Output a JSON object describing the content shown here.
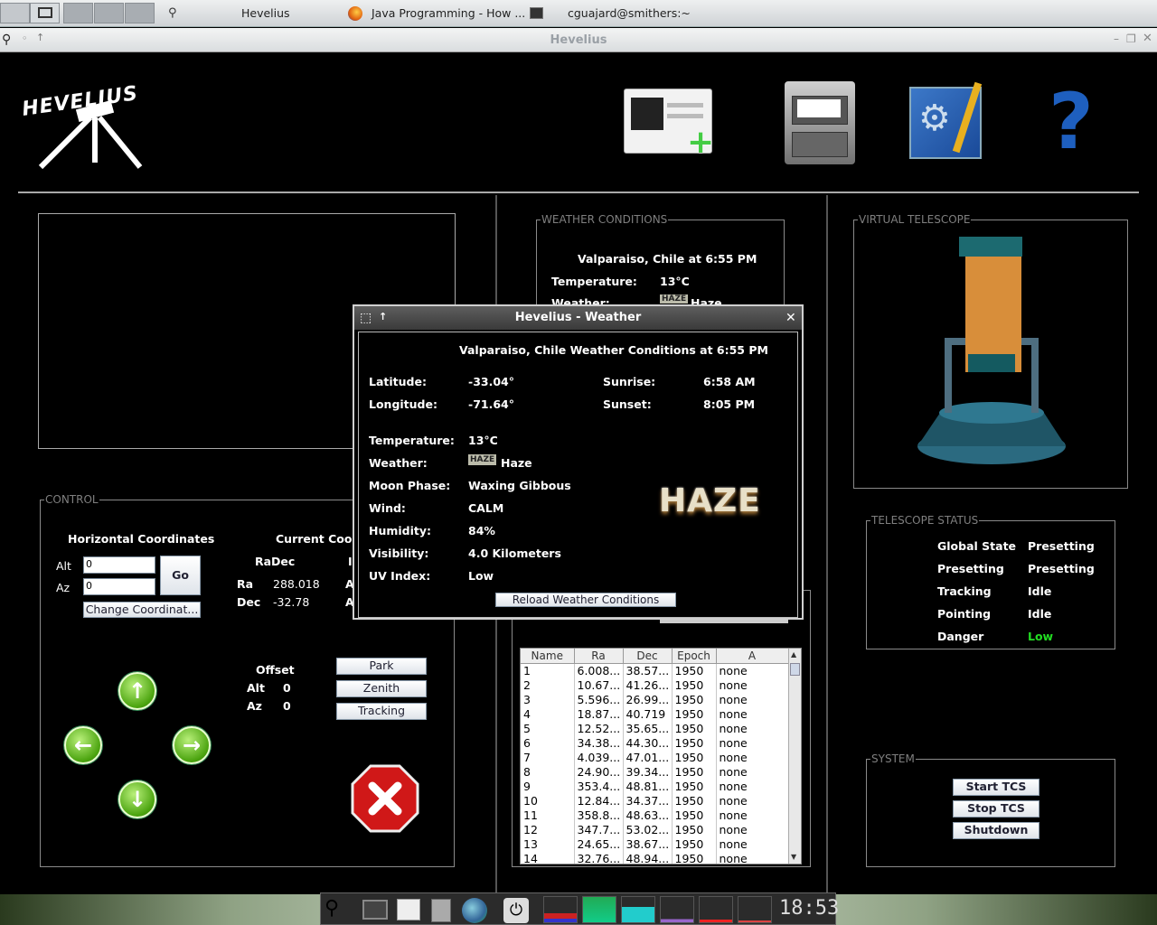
{
  "taskbar": {
    "tasks": [
      "Hevelius",
      "Java Programming - How ...",
      "cguajard@smithers:~"
    ]
  },
  "window": {
    "title": "Hevelius"
  },
  "logo": {
    "text": "HEVELIUS"
  },
  "control": {
    "legend": "CONTROL",
    "horizontal_title": "Horizontal Coordinates",
    "alt_label": "Alt",
    "az_label": "Az",
    "alt_value": "0",
    "az_value": "0",
    "go_label": "Go",
    "change_label": "Change Coordinat...",
    "current_title": "Current Coord",
    "radec_header": "RaDec",
    "radec_header2": "I",
    "ra_label": "Ra",
    "ra_value": "288.018",
    "ra_cut": "A",
    "dec_label": "Dec",
    "dec_value": "-32.78",
    "dec_cut": "A",
    "offset_title": "Offset",
    "offset_alt_label": "Alt",
    "offset_alt_value": "0",
    "offset_az_label": "Az",
    "offset_az_value": "0",
    "park_label": "Park",
    "zenith_label": "Zenith",
    "tracking_label": "Tracking"
  },
  "weather_panel": {
    "legend": "WEATHER CONDITIONS",
    "location": "Valparaiso, Chile at 6:55 PM",
    "temperature_label": "Temperature:",
    "temperature": "13°C",
    "weather_label": "Weather:",
    "weather_value": "Haze",
    "weather_badge": "HAZE"
  },
  "virtual_telescope": {
    "legend": "VIRTUAL TELESCOPE"
  },
  "telescope_status": {
    "legend": "TELESCOPE STATUS",
    "rows": [
      {
        "label": "Global State",
        "value": "Presetting"
      },
      {
        "label": "Presetting",
        "value": "Presetting"
      },
      {
        "label": "Tracking",
        "value": "Idle"
      },
      {
        "label": "Pointing",
        "value": "Idle"
      },
      {
        "label": "Danger",
        "value": "Low"
      }
    ],
    "danger_color": "#22dd22"
  },
  "system": {
    "legend": "SYSTEM",
    "start_label": "Start TCS",
    "stop_label": "Stop TCS",
    "shutdown_label": "Shutdown"
  },
  "catalog": {
    "columns": [
      "Name",
      "Ra",
      "Dec",
      "Epoch",
      "A"
    ],
    "rows": [
      [
        "1",
        "6.008...",
        "38.57...",
        "1950",
        "none"
      ],
      [
        "2",
        "10.67...",
        "41.26...",
        "1950",
        "none"
      ],
      [
        "3",
        "5.596...",
        "26.99...",
        "1950",
        "none"
      ],
      [
        "4",
        "18.87...",
        "40.719",
        "1950",
        "none"
      ],
      [
        "5",
        "12.52...",
        "35.65...",
        "1950",
        "none"
      ],
      [
        "6",
        "34.38...",
        "44.30...",
        "1950",
        "none"
      ],
      [
        "7",
        "4.039...",
        "47.01...",
        "1950",
        "none"
      ],
      [
        "8",
        "24.90...",
        "39.34...",
        "1950",
        "none"
      ],
      [
        "9",
        "353.4...",
        "48.81...",
        "1950",
        "none"
      ],
      [
        "10",
        "12.84...",
        "34.37...",
        "1950",
        "none"
      ],
      [
        "11",
        "358.8...",
        "48.63...",
        "1950",
        "none"
      ],
      [
        "12",
        "347.7...",
        "53.02...",
        "1950",
        "none"
      ],
      [
        "13",
        "24.65...",
        "38.67...",
        "1950",
        "none"
      ],
      [
        "14",
        "32.76...",
        "48.94...",
        "1950",
        "none"
      ]
    ]
  },
  "dialog": {
    "title": "Hevelius - Weather",
    "heading": "Valparaiso, Chile Weather Conditions at 6:55 PM",
    "latitude_label": "Latitude:",
    "latitude": "-33.04°",
    "longitude_label": "Longitude:",
    "longitude": "-71.64°",
    "sunrise_label": "Sunrise:",
    "sunrise": "6:58 AM",
    "sunset_label": "Sunset:",
    "sunset": "8:05 PM",
    "temperature_label": "Temperature:",
    "temperature": "13°C",
    "weather_label": "Weather:",
    "weather": "Haze",
    "weather_badge": "HAZE",
    "big_badge": "HAZE",
    "moon_label": "Moon Phase:",
    "moon": "Waxing Gibbous",
    "wind_label": "Wind:",
    "wind": "CALM",
    "humidity_label": "Humidity:",
    "humidity": "84%",
    "visibility_label": "Visibility:",
    "visibility": "4.0 Kilometers",
    "uv_label": "UV Index:",
    "uv": "Low",
    "reload_label": "Reload Weather Conditions"
  },
  "toolbar": {
    "help_glyph": "?"
  },
  "clock": {
    "time": "18:53"
  }
}
